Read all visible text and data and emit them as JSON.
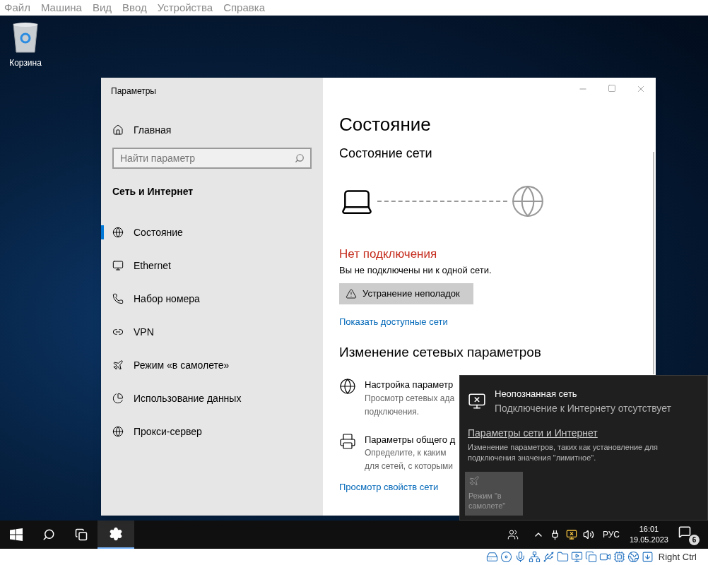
{
  "menu_bar": [
    "Файл",
    "Машина",
    "Вид",
    "Ввод",
    "Устройства",
    "Справка"
  ],
  "desktop_icons": [
    {
      "label": "Корзина"
    }
  ],
  "settings_window": {
    "title": "Параметры",
    "sidebar": {
      "home": "Главная",
      "search": {
        "placeholder": "Найти параметр"
      },
      "section": "Сеть и Интернет",
      "items": [
        {
          "label": "Состояние",
          "kind": "status",
          "selected": true
        },
        {
          "label": "Ethernet",
          "kind": "ethernet",
          "selected": false
        },
        {
          "label": "Набор номера",
          "kind": "dialup",
          "selected": false
        },
        {
          "label": "VPN",
          "kind": "vpn",
          "selected": false
        },
        {
          "label": "Режим «в самолете»",
          "kind": "airplane",
          "selected": false
        },
        {
          "label": "Использование данных",
          "kind": "data",
          "selected": false
        },
        {
          "label": "Прокси-сервер",
          "kind": "proxy",
          "selected": false
        }
      ]
    },
    "content": {
      "title": "Состояние",
      "subtitle": "Состояние сети",
      "connected": false,
      "status": "Нет подключения",
      "status_text": "Вы не подключены ни к одной сети.",
      "troubleshoot_button": "Устранение неполадок",
      "link": "Показать доступные сети",
      "section": "Изменение сетевых параметров",
      "options": [
        {
          "kind": "adapter",
          "title": "Настройка параметр",
          "lines": [
            "Просмотр сетевых ада",
            "подключения."
          ]
        },
        {
          "kind": "sharing",
          "title": "Параметры общего д",
          "lines": [
            "Определите, к каким",
            "для сетей, с которыми"
          ]
        }
      ],
      "bottom_link": "Просмотр свойств сети"
    }
  },
  "network_flyout": {
    "network_name": "Неопознанная сеть",
    "network_status": "Подключение к Интернету отсутствует",
    "settings_link": "Параметры сети и Интернет",
    "settings_text": "Изменение параметров, таких как установление для подключения значения \"лимитное\".",
    "tiles": [
      {
        "label": "Режим \"в самолете\"",
        "on": false
      }
    ]
  },
  "taskbar": {
    "language": "РУС",
    "time": "16:01",
    "date": "19.05.2023",
    "notifications": "6"
  },
  "vm_status_bar": {
    "host_key": "Right Ctrl"
  }
}
